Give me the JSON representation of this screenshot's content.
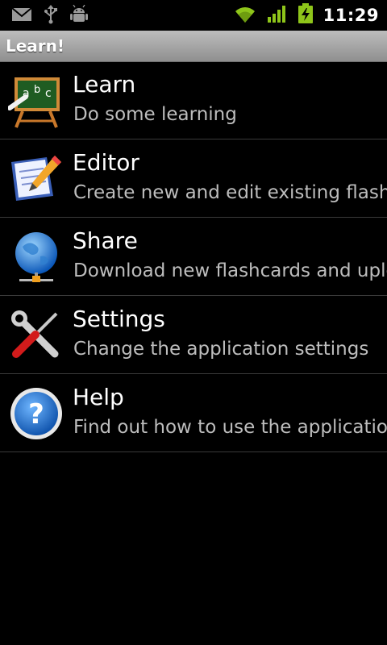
{
  "status_bar": {
    "time": "11:29",
    "icons": [
      "gmail-icon",
      "usb-icon",
      "android-debug-icon",
      "wifi-icon",
      "signal-icon",
      "battery-charging-icon"
    ]
  },
  "app_bar": {
    "title": "Learn!"
  },
  "menu": {
    "items": [
      {
        "title": "Learn",
        "subtitle": "Do some learning",
        "icon": "chalkboard-icon"
      },
      {
        "title": "Editor",
        "subtitle": "Create new and edit existing flashcards",
        "icon": "notepad-pencil-icon"
      },
      {
        "title": "Share",
        "subtitle": "Download new flashcards and upload",
        "icon": "globe-network-icon"
      },
      {
        "title": "Settings",
        "subtitle": "Change the application settings",
        "icon": "wrench-screwdriver-icon"
      },
      {
        "title": "Help",
        "subtitle": "Find out how to use the application",
        "icon": "help-icon"
      }
    ]
  },
  "colors": {
    "background": "#000000",
    "title_bar": "#a8a8a8",
    "accent_green": "#8ec51a",
    "subtitle": "#bdbdbd",
    "divider": "#3a3a3a"
  }
}
